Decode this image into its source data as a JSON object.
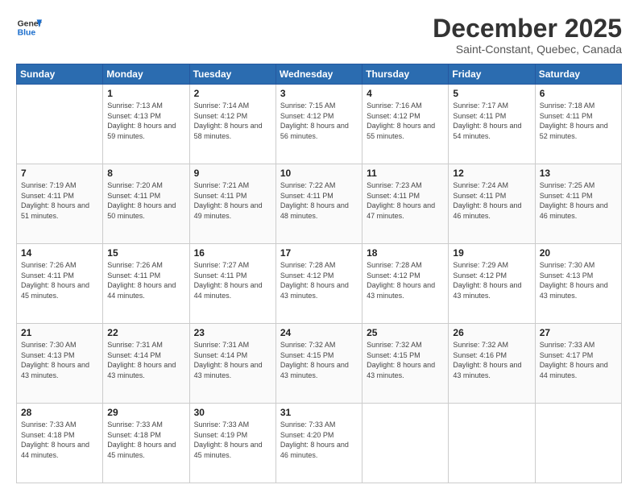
{
  "header": {
    "logo_line1": "General",
    "logo_line2": "Blue",
    "title": "December 2025",
    "subtitle": "Saint-Constant, Quebec, Canada"
  },
  "days_of_week": [
    "Sunday",
    "Monday",
    "Tuesday",
    "Wednesday",
    "Thursday",
    "Friday",
    "Saturday"
  ],
  "weeks": [
    [
      {
        "day": "",
        "sunrise": "",
        "sunset": "",
        "daylight": ""
      },
      {
        "day": "1",
        "sunrise": "Sunrise: 7:13 AM",
        "sunset": "Sunset: 4:13 PM",
        "daylight": "Daylight: 8 hours and 59 minutes."
      },
      {
        "day": "2",
        "sunrise": "Sunrise: 7:14 AM",
        "sunset": "Sunset: 4:12 PM",
        "daylight": "Daylight: 8 hours and 58 minutes."
      },
      {
        "day": "3",
        "sunrise": "Sunrise: 7:15 AM",
        "sunset": "Sunset: 4:12 PM",
        "daylight": "Daylight: 8 hours and 56 minutes."
      },
      {
        "day": "4",
        "sunrise": "Sunrise: 7:16 AM",
        "sunset": "Sunset: 4:12 PM",
        "daylight": "Daylight: 8 hours and 55 minutes."
      },
      {
        "day": "5",
        "sunrise": "Sunrise: 7:17 AM",
        "sunset": "Sunset: 4:11 PM",
        "daylight": "Daylight: 8 hours and 54 minutes."
      },
      {
        "day": "6",
        "sunrise": "Sunrise: 7:18 AM",
        "sunset": "Sunset: 4:11 PM",
        "daylight": "Daylight: 8 hours and 52 minutes."
      }
    ],
    [
      {
        "day": "7",
        "sunrise": "Sunrise: 7:19 AM",
        "sunset": "Sunset: 4:11 PM",
        "daylight": "Daylight: 8 hours and 51 minutes."
      },
      {
        "day": "8",
        "sunrise": "Sunrise: 7:20 AM",
        "sunset": "Sunset: 4:11 PM",
        "daylight": "Daylight: 8 hours and 50 minutes."
      },
      {
        "day": "9",
        "sunrise": "Sunrise: 7:21 AM",
        "sunset": "Sunset: 4:11 PM",
        "daylight": "Daylight: 8 hours and 49 minutes."
      },
      {
        "day": "10",
        "sunrise": "Sunrise: 7:22 AM",
        "sunset": "Sunset: 4:11 PM",
        "daylight": "Daylight: 8 hours and 48 minutes."
      },
      {
        "day": "11",
        "sunrise": "Sunrise: 7:23 AM",
        "sunset": "Sunset: 4:11 PM",
        "daylight": "Daylight: 8 hours and 47 minutes."
      },
      {
        "day": "12",
        "sunrise": "Sunrise: 7:24 AM",
        "sunset": "Sunset: 4:11 PM",
        "daylight": "Daylight: 8 hours and 46 minutes."
      },
      {
        "day": "13",
        "sunrise": "Sunrise: 7:25 AM",
        "sunset": "Sunset: 4:11 PM",
        "daylight": "Daylight: 8 hours and 46 minutes."
      }
    ],
    [
      {
        "day": "14",
        "sunrise": "Sunrise: 7:26 AM",
        "sunset": "Sunset: 4:11 PM",
        "daylight": "Daylight: 8 hours and 45 minutes."
      },
      {
        "day": "15",
        "sunrise": "Sunrise: 7:26 AM",
        "sunset": "Sunset: 4:11 PM",
        "daylight": "Daylight: 8 hours and 44 minutes."
      },
      {
        "day": "16",
        "sunrise": "Sunrise: 7:27 AM",
        "sunset": "Sunset: 4:11 PM",
        "daylight": "Daylight: 8 hours and 44 minutes."
      },
      {
        "day": "17",
        "sunrise": "Sunrise: 7:28 AM",
        "sunset": "Sunset: 4:12 PM",
        "daylight": "Daylight: 8 hours and 43 minutes."
      },
      {
        "day": "18",
        "sunrise": "Sunrise: 7:28 AM",
        "sunset": "Sunset: 4:12 PM",
        "daylight": "Daylight: 8 hours and 43 minutes."
      },
      {
        "day": "19",
        "sunrise": "Sunrise: 7:29 AM",
        "sunset": "Sunset: 4:12 PM",
        "daylight": "Daylight: 8 hours and 43 minutes."
      },
      {
        "day": "20",
        "sunrise": "Sunrise: 7:30 AM",
        "sunset": "Sunset: 4:13 PM",
        "daylight": "Daylight: 8 hours and 43 minutes."
      }
    ],
    [
      {
        "day": "21",
        "sunrise": "Sunrise: 7:30 AM",
        "sunset": "Sunset: 4:13 PM",
        "daylight": "Daylight: 8 hours and 43 minutes."
      },
      {
        "day": "22",
        "sunrise": "Sunrise: 7:31 AM",
        "sunset": "Sunset: 4:14 PM",
        "daylight": "Daylight: 8 hours and 43 minutes."
      },
      {
        "day": "23",
        "sunrise": "Sunrise: 7:31 AM",
        "sunset": "Sunset: 4:14 PM",
        "daylight": "Daylight: 8 hours and 43 minutes."
      },
      {
        "day": "24",
        "sunrise": "Sunrise: 7:32 AM",
        "sunset": "Sunset: 4:15 PM",
        "daylight": "Daylight: 8 hours and 43 minutes."
      },
      {
        "day": "25",
        "sunrise": "Sunrise: 7:32 AM",
        "sunset": "Sunset: 4:15 PM",
        "daylight": "Daylight: 8 hours and 43 minutes."
      },
      {
        "day": "26",
        "sunrise": "Sunrise: 7:32 AM",
        "sunset": "Sunset: 4:16 PM",
        "daylight": "Daylight: 8 hours and 43 minutes."
      },
      {
        "day": "27",
        "sunrise": "Sunrise: 7:33 AM",
        "sunset": "Sunset: 4:17 PM",
        "daylight": "Daylight: 8 hours and 44 minutes."
      }
    ],
    [
      {
        "day": "28",
        "sunrise": "Sunrise: 7:33 AM",
        "sunset": "Sunset: 4:18 PM",
        "daylight": "Daylight: 8 hours and 44 minutes."
      },
      {
        "day": "29",
        "sunrise": "Sunrise: 7:33 AM",
        "sunset": "Sunset: 4:18 PM",
        "daylight": "Daylight: 8 hours and 45 minutes."
      },
      {
        "day": "30",
        "sunrise": "Sunrise: 7:33 AM",
        "sunset": "Sunset: 4:19 PM",
        "daylight": "Daylight: 8 hours and 45 minutes."
      },
      {
        "day": "31",
        "sunrise": "Sunrise: 7:33 AM",
        "sunset": "Sunset: 4:20 PM",
        "daylight": "Daylight: 8 hours and 46 minutes."
      },
      {
        "day": "",
        "sunrise": "",
        "sunset": "",
        "daylight": ""
      },
      {
        "day": "",
        "sunrise": "",
        "sunset": "",
        "daylight": ""
      },
      {
        "day": "",
        "sunrise": "",
        "sunset": "",
        "daylight": ""
      }
    ]
  ]
}
